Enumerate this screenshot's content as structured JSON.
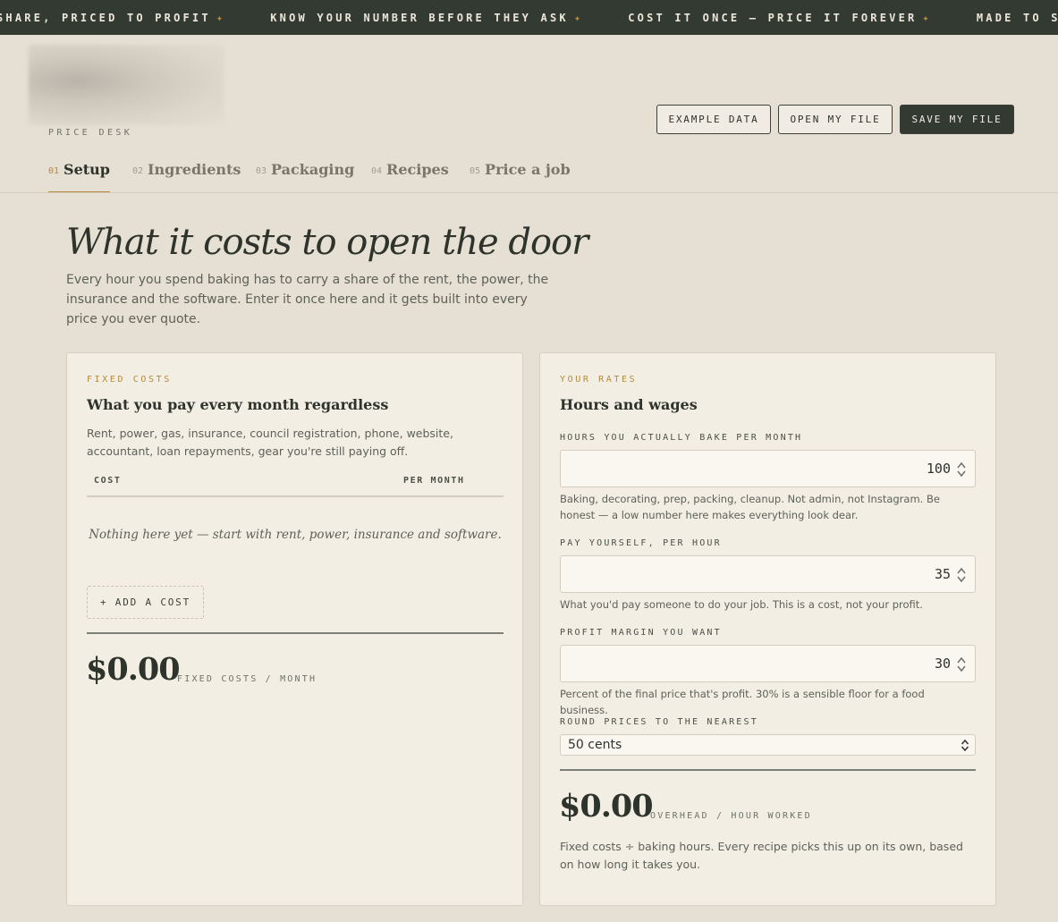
{
  "ticker": {
    "items": [
      "SHARE, PRICED TO PROFIT",
      "KNOW YOUR NUMBER BEFORE THEY ASK",
      "COST IT ONCE — PRICE IT FOREVER",
      "MADE TO SH"
    ],
    "separator": "✦"
  },
  "brand": {
    "subtitle": "PRICE DESK"
  },
  "header": {
    "example_label": "EXAMPLE DATA",
    "open_label": "OPEN MY FILE",
    "save_label": "SAVE MY FILE"
  },
  "tabs": [
    {
      "num": "01",
      "label": "Setup",
      "active": true
    },
    {
      "num": "02",
      "label": "Ingredients",
      "active": false
    },
    {
      "num": "03",
      "label": "Packaging",
      "active": false
    },
    {
      "num": "04",
      "label": "Recipes",
      "active": false
    },
    {
      "num": "05",
      "label": "Price a job",
      "active": false
    }
  ],
  "page": {
    "title": "What it costs to open the door",
    "intro": "Every hour you spend baking has to carry a share of the rent, the power, the insurance and the software. Enter it once here and it gets built into every price you ever quote."
  },
  "fixed_costs": {
    "eyebrow": "FIXED COSTS",
    "title": "What you pay every month regardless",
    "desc": "Rent, power, gas, insurance, council registration, phone, website, accountant, loan repayments, gear you're still paying off.",
    "col_cost": "COST",
    "col_month": "PER MONTH",
    "empty": "Nothing here yet — start with rent, power, insurance and software.",
    "add_label": "+ ADD A COST",
    "total": "$0.00",
    "total_caption": "FIXED COSTS / MONTH"
  },
  "rates": {
    "eyebrow": "YOUR RATES",
    "title": "Hours and wages",
    "hours_label": "HOURS YOU ACTUALLY BAKE PER MONTH",
    "hours_value": "100",
    "hours_help": "Baking, decorating, prep, packing, cleanup. Not admin, not Instagram. Be honest — a low number here makes everything look dear.",
    "pay_label": "PAY YOURSELF, PER HOUR",
    "pay_value": "35",
    "pay_help": "What you'd pay someone to do your job. This is a cost, not your profit.",
    "margin_label": "PROFIT MARGIN YOU WANT",
    "margin_value": "30",
    "margin_help": "Percent of the final price that's profit. 30% is a sensible floor for a food business.",
    "round_label": "ROUND PRICES TO THE NEAREST",
    "round_value": "50 cents",
    "overhead": "$0.00",
    "overhead_caption": "OVERHEAD / HOUR WORKED",
    "overhead_help": "Fixed costs ÷ baking hours. Every recipe picks this up on its own, based on how long it takes you."
  },
  "colors": {
    "ink": "#2e332b",
    "accent": "#b58a3c",
    "page_bg": "#e6dfd3",
    "card_bg": "#f2eee4",
    "dark_bar": "#333a31"
  }
}
